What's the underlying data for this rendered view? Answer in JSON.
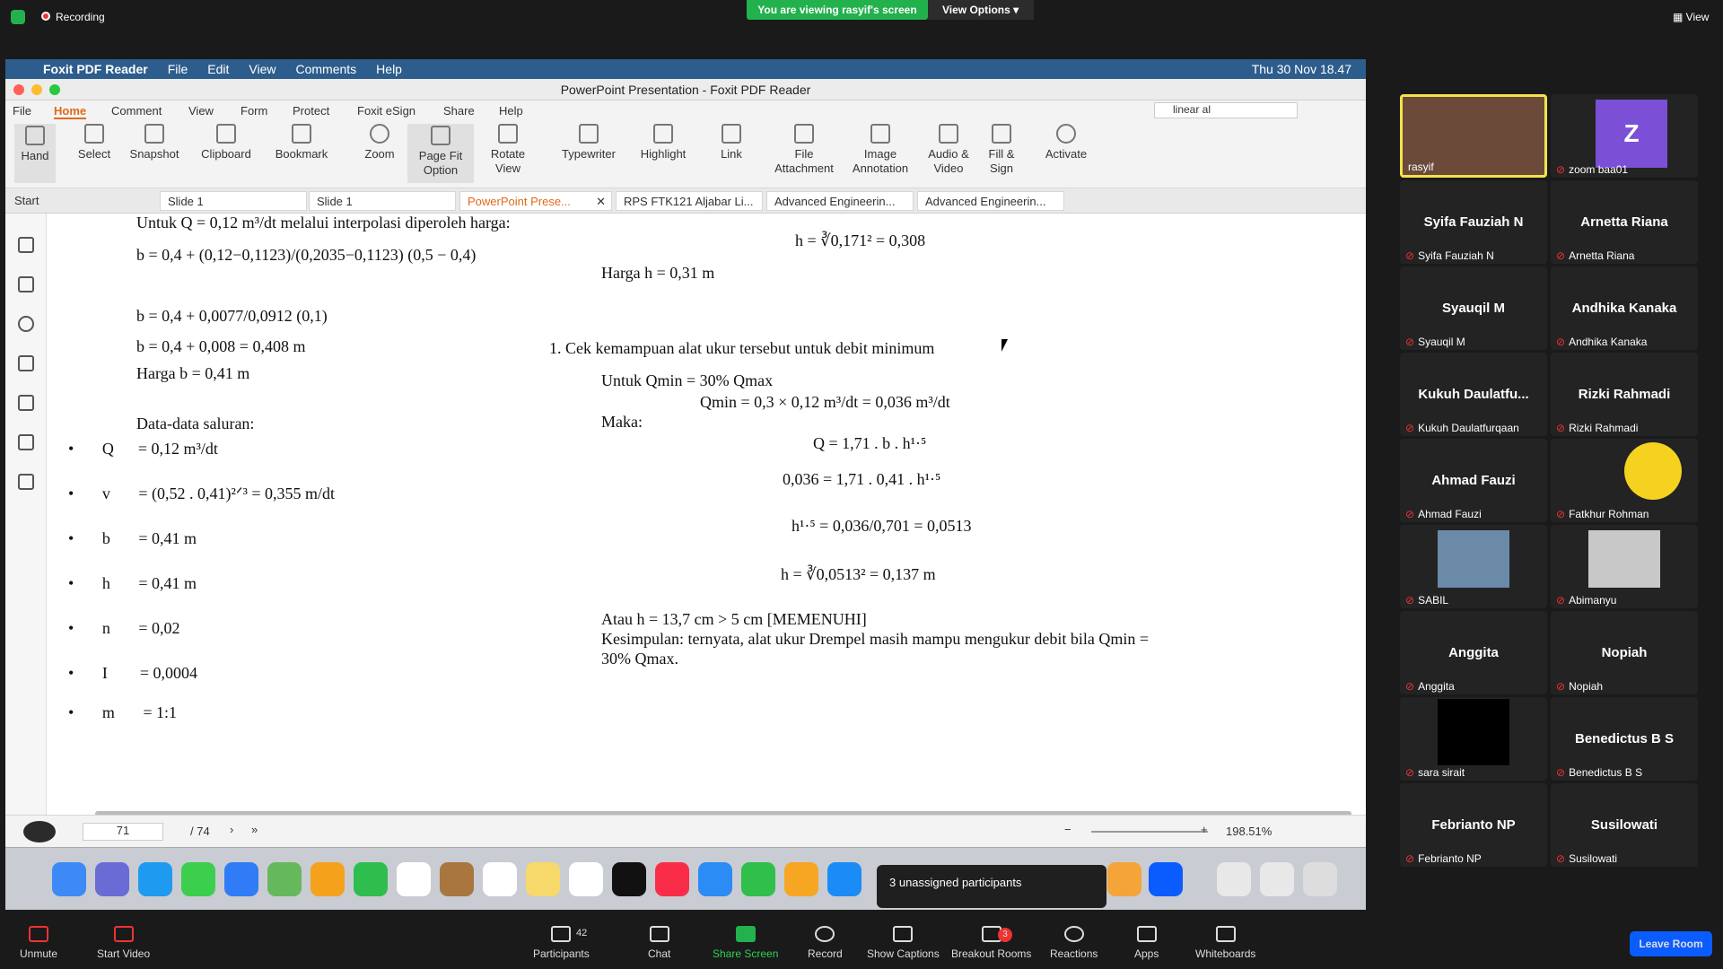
{
  "zoom_top": {
    "recording": "Recording",
    "viewing_banner": "You are viewing rasyif's screen",
    "view_options": "View Options",
    "view_label": "View"
  },
  "mac_menubar": {
    "app": "Foxit PDF Reader",
    "menus": [
      "File",
      "Edit",
      "View",
      "Comments",
      "Help"
    ],
    "datetime": "Thu 30 Nov 18.47"
  },
  "window_title": "PowerPoint Presentation - Foxit PDF Reader",
  "ribbon_tabs": [
    "File",
    "Home",
    "Comment",
    "View",
    "Form",
    "Protect",
    "Foxit eSign",
    "Share",
    "Help"
  ],
  "search_value": "linear al",
  "tools": [
    "Hand",
    "Select",
    "Snapshot",
    "Clipboard",
    "Bookmark",
    "Zoom",
    "Page Fit Option",
    "Rotate View",
    "Typewriter",
    "Highlight",
    "Link",
    "File Attachment",
    "Image Annotation",
    "Audio & Video",
    "Fill & Sign",
    "Activate"
  ],
  "doc_tabs": [
    "Start",
    "Slide 1",
    "Slide 1",
    "PowerPoint Prese...",
    "RPS FTK121 Aljabar Li...",
    "Advanced Engineerin...",
    "Advanced Engineerin..."
  ],
  "pdf": {
    "l1": "Untuk Q = 0,12 m³/dt melalui interpolasi diperoleh harga:",
    "l2": "b = 0,4 + (0,12−0,1123)/(0,2035−0,1123) (0,5 − 0,4)",
    "l3": "b = 0,4 + 0,0077/0,0912 (0,1)",
    "l4": "b = 0,4 + 0,008 = 0,408 m",
    "l5": "Harga b = 0,41 m",
    "l6": "Data-data saluran:",
    "items": [
      [
        "Q",
        "= 0,12 m³/dt"
      ],
      [
        "v",
        "= (0,52 . 0,41)²ᐟ³ = 0,355 m/dt"
      ],
      [
        "b",
        "= 0,41 m"
      ],
      [
        "h",
        "= 0,41 m"
      ],
      [
        "n",
        "= 0,02"
      ],
      [
        "I",
        "= 0,0004"
      ],
      [
        "m",
        "= 1:1"
      ]
    ],
    "r1": "h = ∛0,171² = 0,308",
    "r2": "Harga h = 0,31 m",
    "r3": "1.     Cek kemampuan alat ukur tersebut untuk debit minimum",
    "r4": "Untuk Qmin = 30% Qmax",
    "r5": "Qmin = 0,3 × 0,12 m³/dt = 0,036 m³/dt",
    "r6": "Maka:",
    "r7": "Q = 1,71 . b . h¹·⁵",
    "r8": "0,036 = 1,71 . 0,41 . h¹·⁵",
    "r9": "h¹·⁵ = 0,036/0,701 = 0,0513",
    "r10": "h = ∛0,0513² = 0,137 m",
    "r11": "Atau h = 13,7 cm > 5 cm [MEMENUHI]",
    "r12": "Kesimpulan: ternyata, alat ukur Drempel masih mampu mengukur debit bila Qmin =",
    "r13": "30% Qmax."
  },
  "status": {
    "page": "71",
    "total": "/ 74",
    "zoom": "198.51%"
  },
  "unassigned_popup": "3 unassigned participants",
  "participants": [
    {
      "big": "",
      "label": "rasyif"
    },
    {
      "big": "Z",
      "label": "zoom baa01"
    },
    {
      "big": "Syifa Fauziah N",
      "label": "Syifa Fauziah N"
    },
    {
      "big": "Arnetta Riana",
      "label": "Arnetta Riana"
    },
    {
      "big": "Syauqil M",
      "label": "Syauqil M"
    },
    {
      "big": "Andhika Kanaka",
      "label": "Andhika Kanaka"
    },
    {
      "big": "Kukuh  Daulatfu...",
      "label": "Kukuh Daulatfurqaan"
    },
    {
      "big": "Rizki Rahmadi",
      "label": "Rizki Rahmadi"
    },
    {
      "big": "Ahmad Fauzi",
      "label": "Ahmad Fauzi"
    },
    {
      "big": "",
      "label": "Fatkhur Rohman"
    },
    {
      "big": "",
      "label": "SABIL"
    },
    {
      "big": "",
      "label": "Abimanyu"
    },
    {
      "big": "Anggita",
      "label": "Anggita"
    },
    {
      "big": "Nopiah",
      "label": "Nopiah"
    },
    {
      "big": "",
      "label": "sara sirait"
    },
    {
      "big": "Benedictus B S",
      "label": "Benedictus B S"
    },
    {
      "big": "Febrianto NP",
      "label": "Febrianto NP"
    },
    {
      "big": "Susilowati",
      "label": "Susilowati"
    }
  ],
  "bottom": {
    "unmute": "Unmute",
    "start_video": "Start Video",
    "participants": "Participants",
    "participants_count": "42",
    "chat": "Chat",
    "share": "Share Screen",
    "record": "Record",
    "captions": "Show Captions",
    "breakout": "Breakout Rooms",
    "breakout_badge": "3",
    "reactions": "Reactions",
    "apps": "Apps",
    "whiteboards": "Whiteboards",
    "leave": "Leave Room"
  },
  "colors": {
    "banner": "#23b14d",
    "leave": "#0b5cff",
    "active_tab": "#e06a1b"
  }
}
